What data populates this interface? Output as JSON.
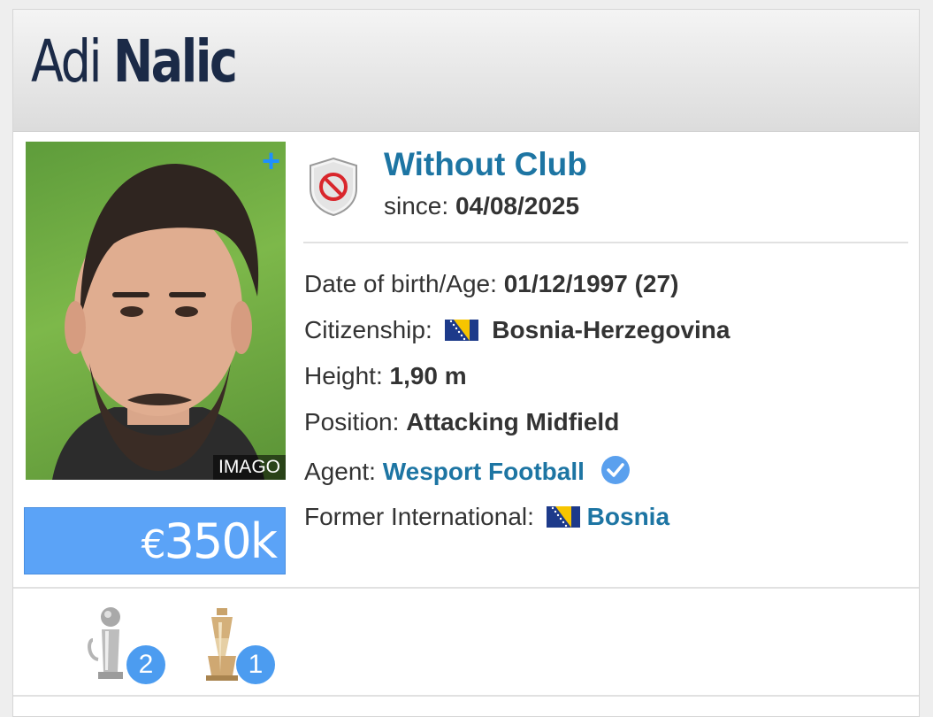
{
  "player": {
    "first_name": "Adi",
    "last_name": "Nalic"
  },
  "photo": {
    "credit": "IMAGO",
    "add_icon": "plus-icon"
  },
  "market_value": {
    "currency": "€",
    "amount": "350k"
  },
  "club": {
    "status": "Without Club",
    "since_label": "since:",
    "since_date": "04/08/2025",
    "badge_icon": "no-club-badge-icon"
  },
  "info": {
    "dob_label": "Date of birth/Age:",
    "dob_value": "01/12/1997 (27)",
    "citizenship_label": "Citizenship:",
    "citizenship_value": "Bosnia-Herzegovina",
    "height_label": "Height:",
    "height_value": "1,90 m",
    "position_label": "Position:",
    "position_value": "Attacking Midfield",
    "agent_label": "Agent:",
    "agent_value": "Wesport Football",
    "former_international_label": "Former International:",
    "former_international_value": "Bosnia"
  },
  "trophies": [
    {
      "icon": "silver-trophy-icon",
      "count": "2"
    },
    {
      "icon": "gold-trophy-icon",
      "count": "1"
    }
  ],
  "colors": {
    "link_blue": "#1d75a3",
    "market_value_bg": "#5ba3f7",
    "badge_blue": "#4c9cf0",
    "name_navy": "#1b2a47"
  }
}
